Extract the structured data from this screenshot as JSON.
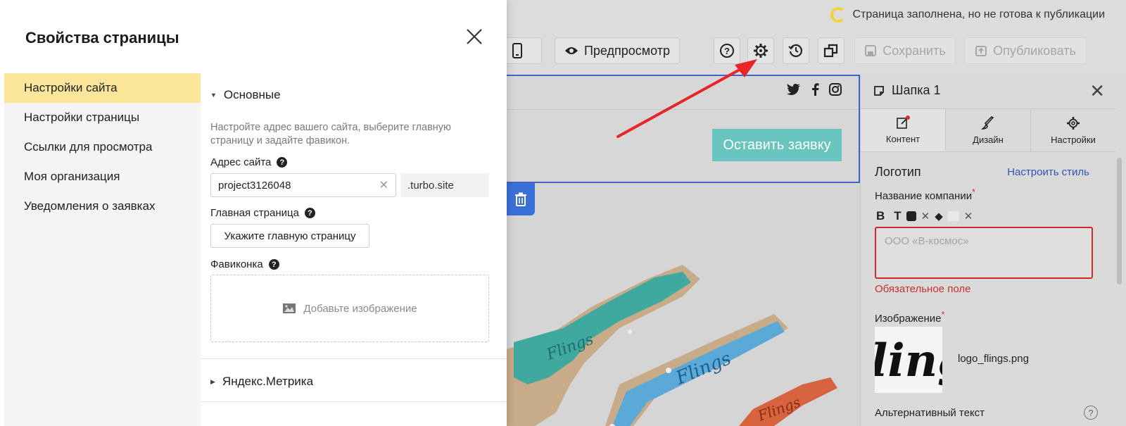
{
  "status": {
    "text": "Страница заполнена, но не готова к публикации"
  },
  "toolbar": {
    "preview_label": "Предпросмотр",
    "save_label": "Сохранить",
    "publish_label": "Опубликовать"
  },
  "canvas": {
    "cta_label": "Оставить заявку",
    "product_text": "Flings"
  },
  "right_panel": {
    "title": "Шапка 1",
    "tabs": [
      {
        "label": "Контент",
        "icon": "edit-icon"
      },
      {
        "label": "Дизайн",
        "icon": "brush-icon"
      },
      {
        "label": "Настройки",
        "icon": "gear-icon"
      }
    ],
    "section_title": "Логотип",
    "style_link": "Настроить стиль",
    "company_label": "Название компании",
    "company_placeholder": "ООО «В-космос»",
    "error_text": "Обязательное поле",
    "image_label": "Изображение",
    "image_filename": "logo_flings.png",
    "logo_text": "ling",
    "alt_label": "Альтернативный текст"
  },
  "modal": {
    "title": "Свойства страницы",
    "nav": [
      {
        "label": "Настройки сайта",
        "active": true
      },
      {
        "label": "Настройки страницы",
        "active": false
      },
      {
        "label": "Ссылки для просмотра",
        "active": false
      },
      {
        "label": "Моя организация",
        "active": false
      },
      {
        "label": "Уведомления о заявках",
        "active": false
      }
    ],
    "section_main": "Основные",
    "description": "Настройте адрес вашего сайта, выберите главную страницу и задайте фавикон.",
    "address_label": "Адрес сайта",
    "address_value": "project3126048",
    "address_suffix": ".turbo.site",
    "main_page_label": "Главная страница",
    "main_page_button": "Укажите главную страницу",
    "favicon_label": "Фавиконка",
    "favicon_drop": "Добавьте изображение",
    "section_metrika": "Яндекс.Метрика"
  },
  "colors": {
    "nav_active": "#fbe69a",
    "cta": "#67c4be",
    "error": "#cc2b2b",
    "link": "#2c56b8",
    "arrow": "#e8262a",
    "selection": "#3f63c6"
  }
}
